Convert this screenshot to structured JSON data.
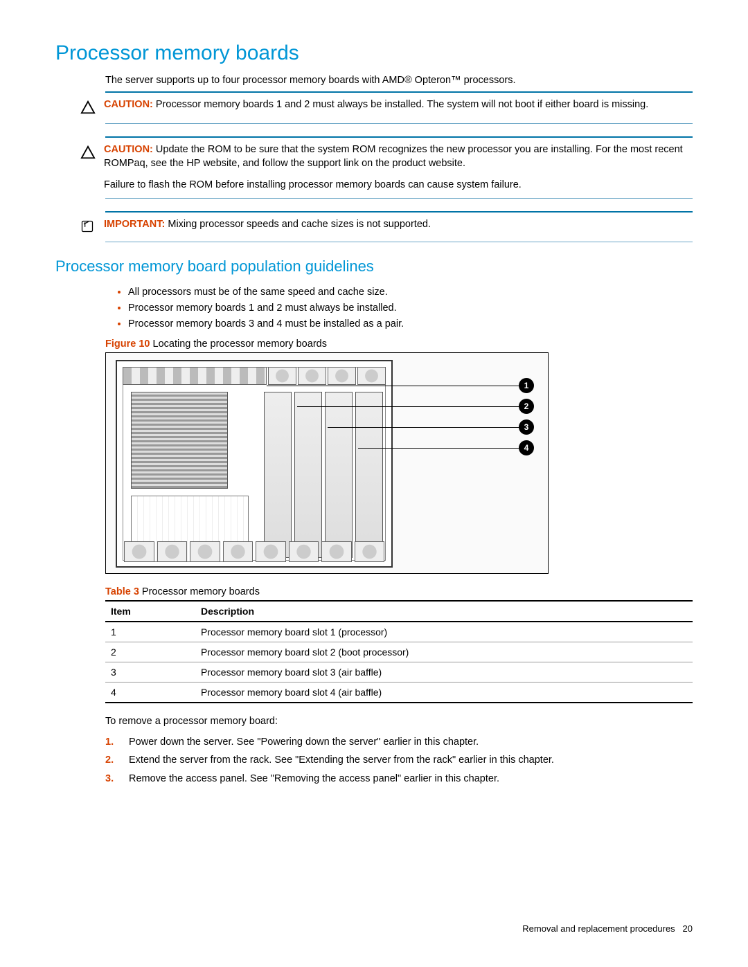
{
  "title": "Processor memory boards",
  "intro": "The server supports up to four processor memory boards with AMD® Opteron™ processors.",
  "caution1_label": "CAUTION:",
  "caution1": "Processor memory boards 1 and 2 must always be installed. The system will not boot if either board is missing.",
  "caution2_label": "CAUTION:",
  "caution2a": "Update the ROM to be sure that the system ROM recognizes the new processor you are installing. For the most recent ROMPaq, see the HP website, and follow the support link on the product website.",
  "caution2b": "Failure to flash the ROM before installing processor memory boards can cause system failure.",
  "important_label": "IMPORTANT:",
  "important": "Mixing processor speeds and cache sizes is not supported.",
  "h2": "Processor memory board population guidelines",
  "bullets": [
    "All processors must be of the same speed and cache size.",
    "Processor memory boards 1 and 2 must always be installed.",
    "Processor memory boards 3 and 4 must be installed as a pair."
  ],
  "figure_label": "Figure 10",
  "figure_caption": "Locating the processor memory boards",
  "callouts": [
    "1",
    "2",
    "3",
    "4"
  ],
  "slot_labels": [
    "1",
    "2",
    "3",
    "4"
  ],
  "table_label": "Table 3",
  "table_caption": "Processor memory boards",
  "table_headers": {
    "item": "Item",
    "desc": "Description"
  },
  "table_rows": [
    {
      "item": "1",
      "desc": "Processor memory board slot 1 (processor)"
    },
    {
      "item": "2",
      "desc": "Processor memory board slot 2 (boot processor)"
    },
    {
      "item": "3",
      "desc": "Processor memory board slot 3 (air baffle)"
    },
    {
      "item": "4",
      "desc": "Processor memory board slot 4 (air baffle)"
    }
  ],
  "remove_intro": "To remove a processor memory board:",
  "steps": [
    {
      "n": "1.",
      "t": "Power down the server. See \"Powering down the server\" earlier in this chapter."
    },
    {
      "n": "2.",
      "t": "Extend the server from the rack. See \"Extending the server from the rack\" earlier in this chapter."
    },
    {
      "n": "3.",
      "t": "Remove the access panel. See \"Removing the access panel\" earlier in this chapter."
    }
  ],
  "footer_text": "Removal and replacement procedures",
  "footer_page": "20"
}
